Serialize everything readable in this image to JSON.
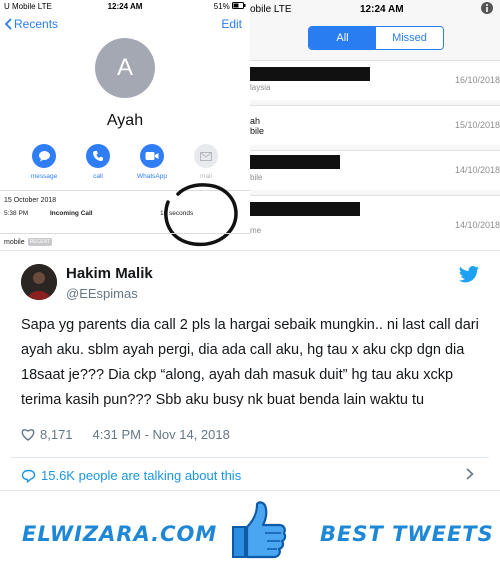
{
  "left_screen": {
    "status": {
      "carrier": "U Mobile  LTE",
      "time": "12:24 AM",
      "battery": "51%"
    },
    "nav": {
      "back_label": "Recents",
      "edit_label": "Edit"
    },
    "contact": {
      "initial": "A",
      "name": "Ayah"
    },
    "actions": [
      {
        "label": "message",
        "icon": "message-icon"
      },
      {
        "label": "call",
        "icon": "phone-icon"
      },
      {
        "label": "WhatsApp",
        "icon": "video-icon"
      },
      {
        "label": "mail",
        "icon": "mail-icon"
      }
    ],
    "call": {
      "date": "15 October 2018",
      "time": "5:38 PM",
      "type": "Incoming Call",
      "duration": "18 seconds"
    },
    "mobile": {
      "label": "mobile",
      "badge": "RECENT"
    }
  },
  "right_screen": {
    "status": {
      "carrier": "obile  LTE",
      "time": "12:24 AM"
    },
    "tabs": [
      {
        "label": "All",
        "active": true
      },
      {
        "label": "Missed",
        "active": false
      }
    ],
    "logs": [
      {
        "sub": "laysia",
        "date": "16/10/2018"
      },
      {
        "sub": "ah\nbile",
        "date": "15/10/2018"
      },
      {
        "sub": "bile",
        "date": "14/10/2018"
      },
      {
        "sub": "me",
        "date": "14/10/2018"
      }
    ]
  },
  "tweet": {
    "name": "Hakim Malik",
    "handle": "@EEspimas",
    "text": "Sapa yg parents dia call 2 pls la hargai sebaik mungkin.. ni last call dari ayah aku. sblm ayah pergi, dia ada call aku, hg tau x aku ckp dgn dia 18saat je??? Dia ckp “along, ayah dah masuk duit” hg tau aku xckp terima kasih pun??? Sbb aku busy nk buat benda lain waktu tu",
    "likes": "8,171",
    "timestamp": "4:31 PM - Nov 14, 2018",
    "talking": "15.6K people are talking about this"
  },
  "banner": {
    "site": "ELWIZARA.COM",
    "tagline": "BEST TWEETS"
  },
  "colors": {
    "ios_blue": "#2a7df0",
    "twitter_blue": "#1da1f2",
    "banner_blue": "#1e88d6"
  }
}
